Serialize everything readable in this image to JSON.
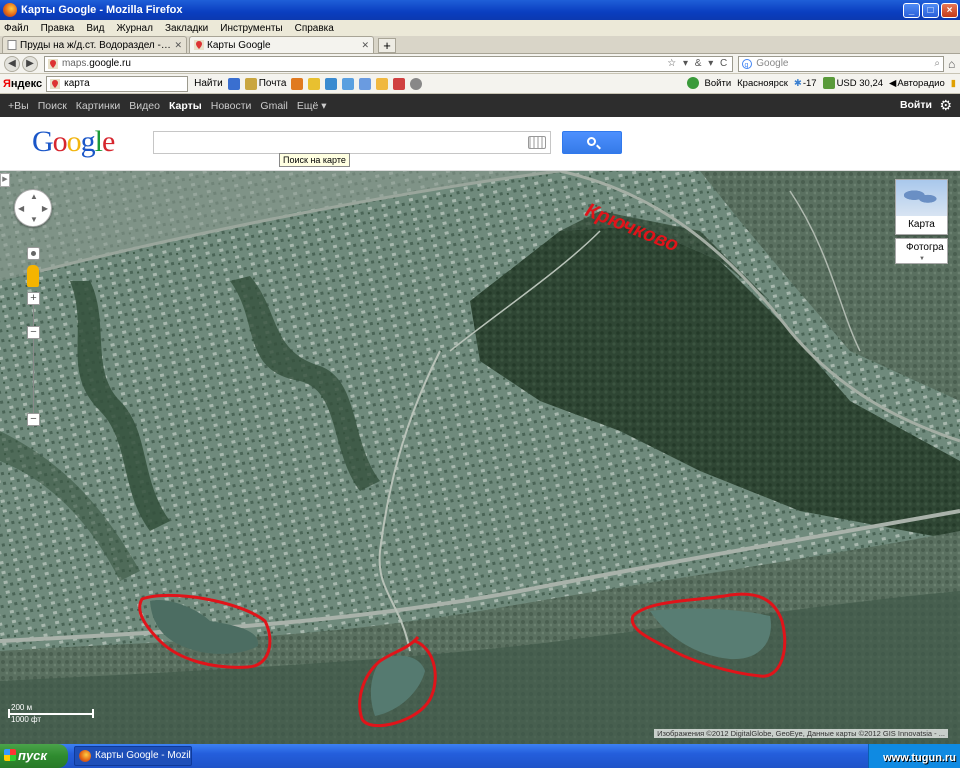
{
  "window": {
    "title": "Карты Google - Mozilla Firefox"
  },
  "menu": [
    "Файл",
    "Правка",
    "Вид",
    "Журнал",
    "Закладки",
    "Инструменты",
    "Справка"
  ],
  "tabs": [
    {
      "label": "Пруды на ж/д.ст. Водораздел - Озера, ..."
    },
    {
      "label": "Карты Google"
    }
  ],
  "nav": {
    "url_host": "maps.",
    "url_domain": "google.ru",
    "search_placeholder": "Google"
  },
  "yandex": {
    "logo_main": "Я",
    "logo_rest": "ндекс",
    "input_value": "карта",
    "find_label": "Найти",
    "mail_label": "Почта",
    "signin_label": "Войти",
    "city": "Красноярск",
    "temp": "-17",
    "usd": "USD 30,24",
    "radio": "Авторадио"
  },
  "gbar": {
    "items": [
      "+Вы",
      "Поиск",
      "Картинки",
      "Видео",
      "Карты",
      "Новости",
      "Gmail",
      "Ещё ▾"
    ],
    "signin": "Войти"
  },
  "google": {
    "logo": [
      "G",
      "o",
      "o",
      "g",
      "l",
      "e"
    ],
    "tooltip": "Поиск на карте"
  },
  "map": {
    "label_overlay": "Крючково",
    "map_switch": "Карта",
    "photo_switch": "Фотогра",
    "scale_m": "200 м",
    "scale_ft": "1000 фт",
    "copyright": "Изображения ©2012 DigitalGlobe, GeoEye, Данные карты ©2012 GIS Innovatsia - ..."
  },
  "taskbar": {
    "start": "пуск",
    "item": "Карты Google - Mozill...",
    "watermark": "www.tugun.ru"
  },
  "colors": {
    "ink_red": "#e0141a",
    "google_blue": "#4d90fe"
  }
}
